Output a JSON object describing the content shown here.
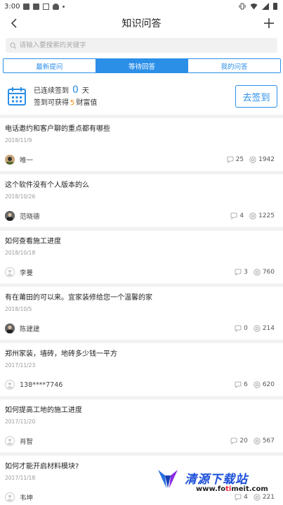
{
  "status_bar": {
    "time": "3:00"
  },
  "header": {
    "title": "知识问答"
  },
  "search": {
    "placeholder": "请输入要搜索的关键字"
  },
  "tabs": [
    {
      "label": "最新提问",
      "active": false
    },
    {
      "label": "等待回答",
      "active": true
    },
    {
      "label": "我的问答",
      "active": false
    }
  ],
  "signin": {
    "line1_prefix": "已连续签到",
    "days": "0",
    "line1_suffix": "天",
    "line2_prefix": "签到可获得",
    "reward": "5",
    "line2_suffix": "财富值",
    "button_label": "去签到"
  },
  "questions": [
    {
      "title": "电话邀约和客户聊的重点都有哪些",
      "date": "2018/11/9",
      "user": "唯一",
      "comments": "25",
      "views": "1942",
      "avatar": "photo"
    },
    {
      "title": "这个软件没有个人版本的么",
      "date": "2018/10/26",
      "user": "范晓德",
      "comments": "4",
      "views": "1225",
      "avatar": "dark"
    },
    {
      "title": "如何查看施工进度",
      "date": "2018/10/18",
      "user": "李曼",
      "comments": "3",
      "views": "760",
      "avatar": "empty"
    },
    {
      "title": "有在莆田的可以来。宜家装修给您一个温馨的家",
      "date": "2018/10/5",
      "user": "陈建建",
      "comments": "0",
      "views": "214",
      "avatar": "dark"
    },
    {
      "title": "郑州家装，墙砖，地砖多少钱一平方",
      "date": "2017/11/23",
      "user": "138****7746",
      "comments": "6",
      "views": "620",
      "avatar": "empty"
    },
    {
      "title": "如何提高工地的施工进度",
      "date": "2017/11/20",
      "user": "肖智",
      "comments": "20",
      "views": "567",
      "avatar": "empty"
    },
    {
      "title": "如何才能开启材料模块?",
      "date": "2017/11/18",
      "user": "韦坤",
      "comments": "4",
      "views": "221",
      "avatar": "empty"
    }
  ],
  "watermark": {
    "text": "清源下载站",
    "url_main": "www.fo",
    "url_mid": "ti",
    "url_end": "meit.com"
  },
  "colors": {
    "accent": "#2b8fe8",
    "reward": "#ff8a00"
  }
}
